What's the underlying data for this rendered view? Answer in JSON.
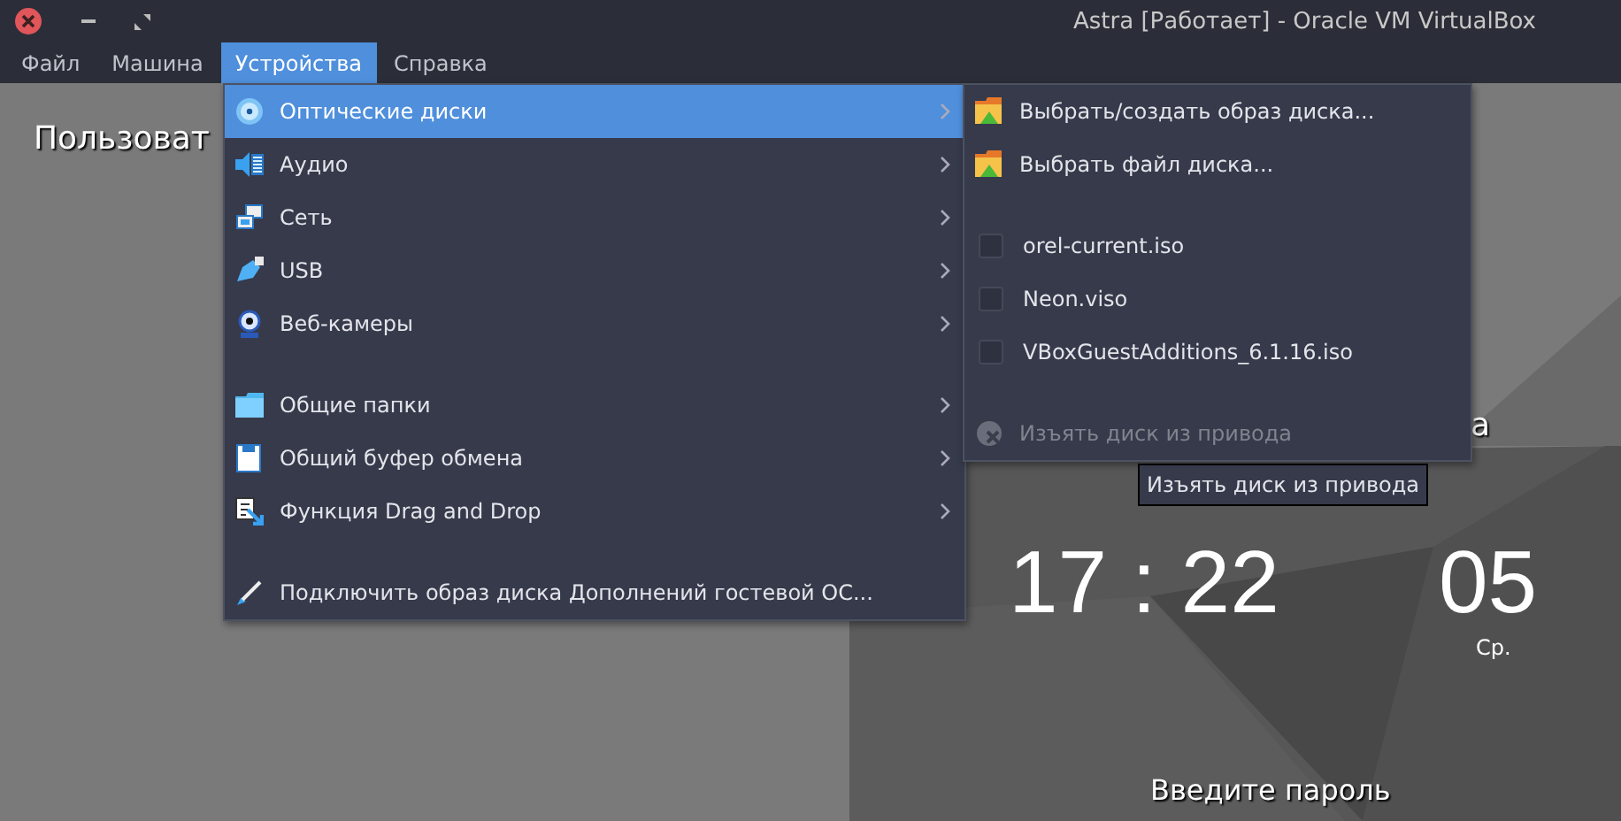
{
  "window": {
    "title": "Astra [Работает] - Oracle VM VirtualBox"
  },
  "menubar": [
    {
      "label": "Файл",
      "selected": false
    },
    {
      "label": "Машина",
      "selected": false
    },
    {
      "label": "Устройства",
      "selected": true
    },
    {
      "label": "Справка",
      "selected": false
    }
  ],
  "guest_screen": {
    "greeting": "Пользоват",
    "name_fragment": "а",
    "clock": "17 : 22",
    "seconds": "05",
    "weekday": "Ср.",
    "password_prompt": "Введите пароль"
  },
  "devices_menu": [
    {
      "kind": "item",
      "label": "Оптические диски",
      "submenu": true,
      "selected": true
    },
    {
      "kind": "item",
      "label": "Аудио",
      "submenu": true,
      "selected": false
    },
    {
      "kind": "item",
      "label": "Сеть",
      "submenu": true,
      "selected": false
    },
    {
      "kind": "item",
      "label": "USB",
      "submenu": true,
      "selected": false
    },
    {
      "kind": "item",
      "label": "Веб-камеры",
      "submenu": true,
      "selected": false
    },
    {
      "kind": "separator"
    },
    {
      "kind": "item",
      "label": "Общие папки",
      "submenu": true,
      "selected": false
    },
    {
      "kind": "item",
      "label": "Общий буфер обмена",
      "submenu": true,
      "selected": false
    },
    {
      "kind": "item",
      "label": "Функция Drag and Drop",
      "submenu": true,
      "selected": false
    },
    {
      "kind": "separator"
    },
    {
      "kind": "item",
      "label": "Подключить образ диска Дополнений гостевой ОС...",
      "submenu": false,
      "selected": false
    }
  ],
  "optical_submenu": [
    {
      "kind": "action",
      "label": "Выбрать/создать образ диска...",
      "disabled": false
    },
    {
      "kind": "action",
      "label": "Выбрать файл диска...",
      "disabled": false
    },
    {
      "kind": "separator"
    },
    {
      "kind": "check",
      "label": "orel-current.iso",
      "checked": false
    },
    {
      "kind": "check",
      "label": "Neon.viso",
      "checked": false
    },
    {
      "kind": "check",
      "label": "VBoxGuestAdditions_6.1.16.iso",
      "checked": false
    },
    {
      "kind": "separator"
    },
    {
      "kind": "eject",
      "label": "Изъять диск из привода",
      "disabled": true
    }
  ],
  "tooltip": "Изъять диск из привода"
}
